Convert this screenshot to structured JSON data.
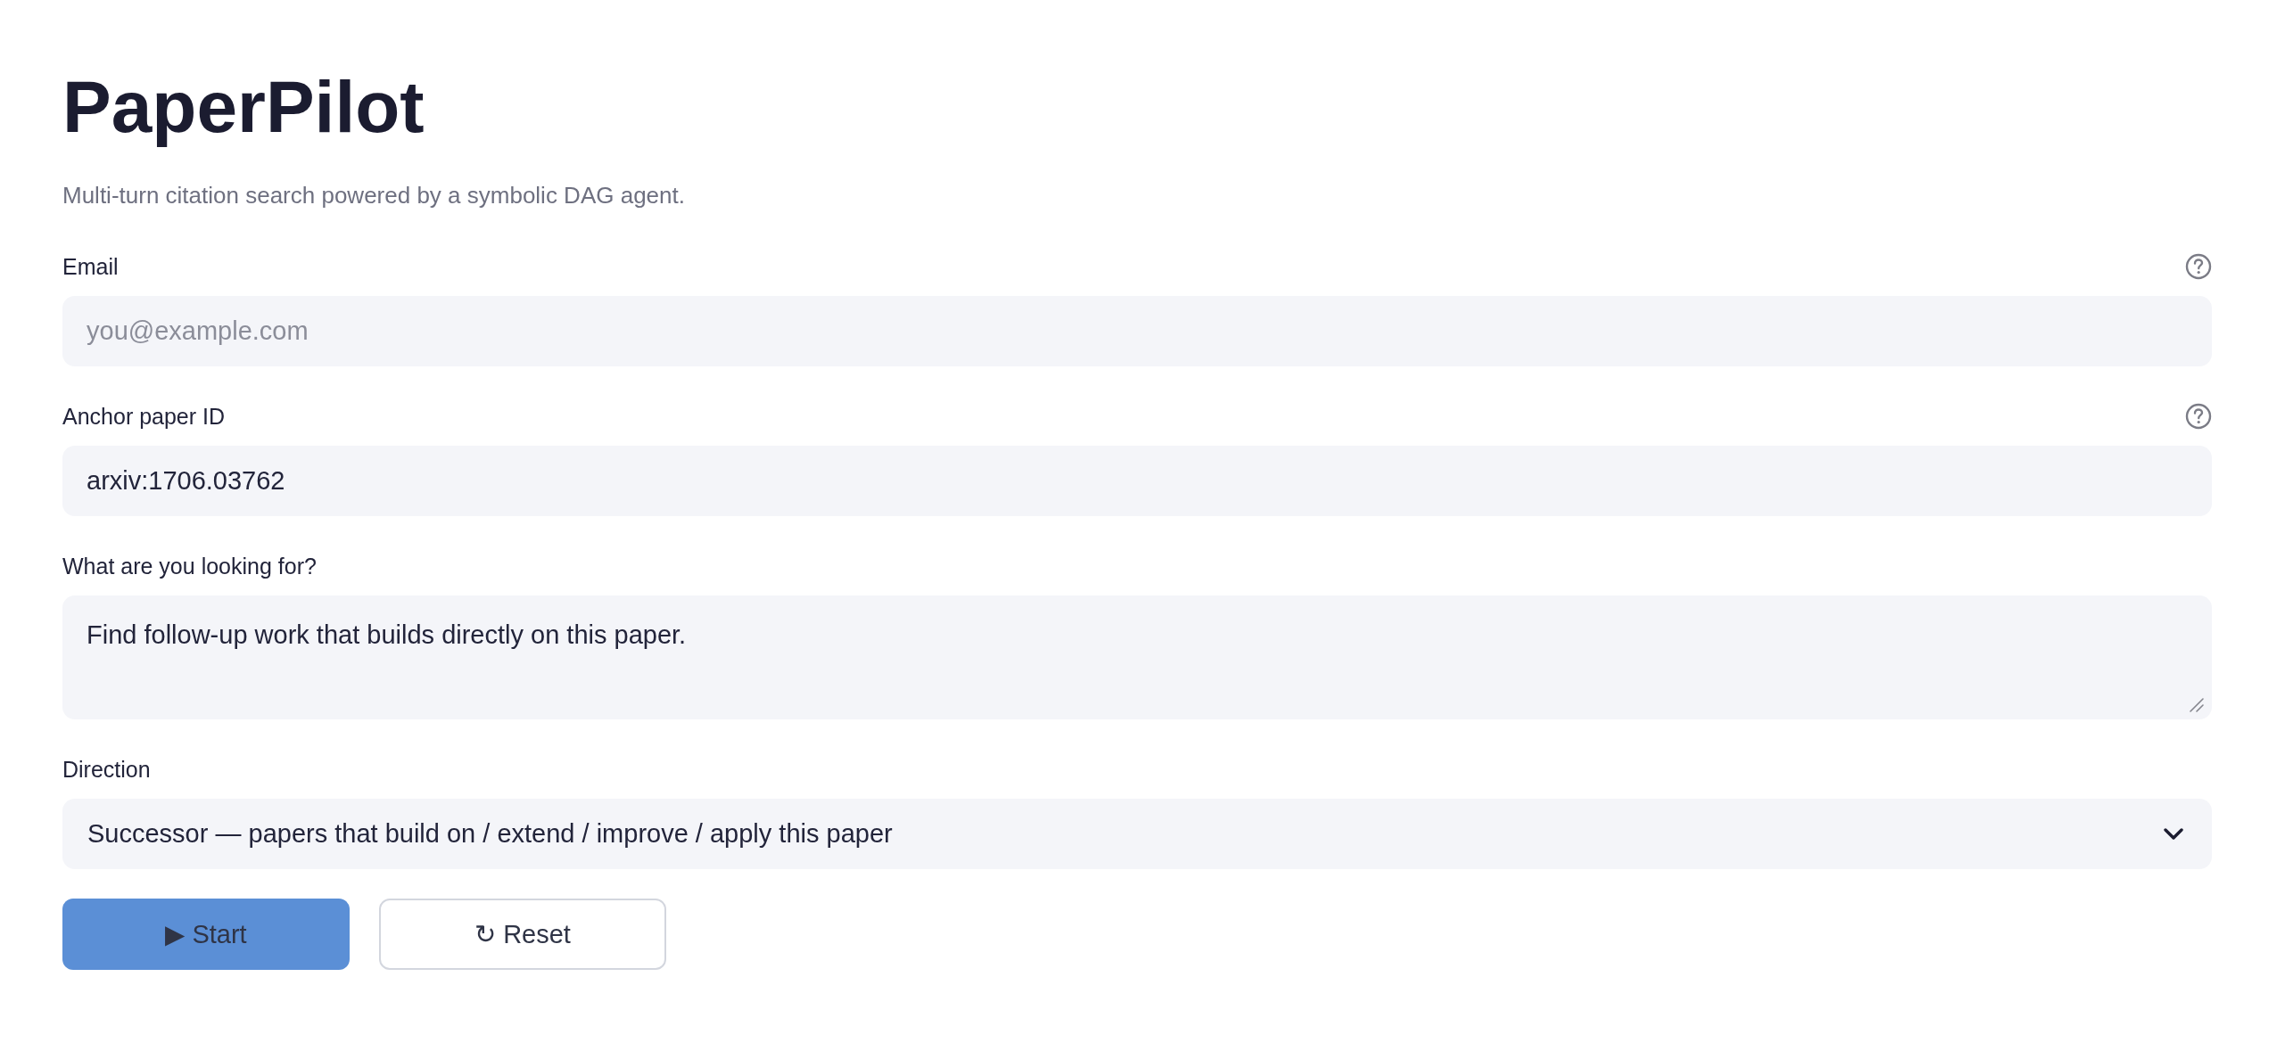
{
  "app": {
    "title": "PaperPilot",
    "subtitle": "Multi-turn citation search powered by a symbolic DAG agent."
  },
  "fields": [
    {
      "kind": "text",
      "label": "Email",
      "help": true,
      "placeholder": "you@example.com"
    },
    {
      "kind": "text",
      "label": "Anchor paper ID",
      "help": true,
      "value": "arxiv:1706.03762"
    },
    {
      "kind": "textarea",
      "label": "What are you looking for?",
      "help": false,
      "value": "Find follow-up work that builds directly on this paper."
    },
    {
      "kind": "select",
      "label": "Direction",
      "help": false,
      "value": "Successor — papers that build on / extend / improve / apply this paper"
    }
  ],
  "buttons": [
    {
      "kind": "primary",
      "label": "▶ Start"
    },
    {
      "kind": "secondary",
      "label": "↻ Reset"
    }
  ]
}
